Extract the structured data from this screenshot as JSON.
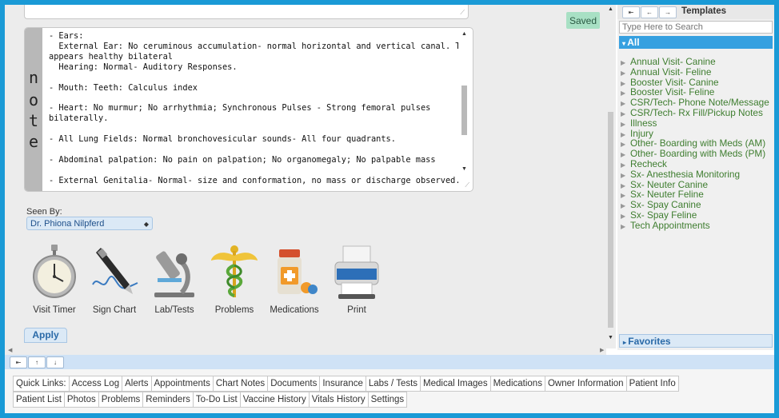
{
  "status": {
    "saved": "Saved"
  },
  "note": {
    "tab_letters": [
      "n",
      "o",
      "t",
      "e"
    ],
    "text": "- Ears:\n  External Ear: No ceruminous accumulation- normal horizontal and vertical canal. TM\nappears healthy bilateral\n  Hearing: Normal- Auditory Responses.\n\n- Mouth: Teeth: Calculus index\n\n- Heart: No murmur; No arrhythmia; Synchronous Pulses - Strong femoral pulses\nbilaterally.\n\n- All Lung Fields: Normal bronchovesicular sounds- All four quadrants.\n\n- Abdominal palpation: No pain on palpation; No organomegaly; No palpable mass\n\n- External Genitalia- Normal- size and conformation, no mass or discharge observed."
  },
  "seen_by": {
    "label": "Seen By:",
    "value": "Dr. Phiona Nilpferd"
  },
  "tools": [
    {
      "label": "Visit Timer"
    },
    {
      "label": "Sign Chart"
    },
    {
      "label": "Lab/Tests"
    },
    {
      "label": "Problems"
    },
    {
      "label": "Medications"
    },
    {
      "label": "Print"
    }
  ],
  "apply_label": "Apply",
  "templates": {
    "title": "Templates",
    "search_placeholder": "Type Here to Search",
    "all_label": "All",
    "items": [
      "Annual Visit- Canine",
      "Annual Visit- Feline",
      "Booster Visit- Canine",
      "Booster Visit- Feline",
      "CSR/Tech- Phone Note/Message",
      "CSR/Tech- Rx Fill/Pickup Notes",
      "Illness",
      "Injury",
      "Other- Boarding with Meds (AM)",
      "Other- Boarding with Meds (PM)",
      "Recheck",
      "Sx- Anesthesia Monitoring",
      "Sx- Neuter Canine",
      "Sx- Neuter Feline",
      "Sx- Spay Canine",
      "Sx- Spay Feline",
      "Tech Appointments"
    ],
    "favorites_label": "Favorites"
  },
  "quick_links": {
    "row1": [
      "Quick Links:",
      "Access Log",
      "Alerts",
      "Appointments",
      "Chart Notes",
      "Documents",
      "Insurance",
      "Labs / Tests",
      "Medical Images",
      "Medications",
      "Owner Information",
      "Patient Info"
    ],
    "row2": [
      "Patient List",
      "Photos",
      "Problems",
      "Reminders",
      "To-Do List",
      "Vaccine History",
      "Vitals History",
      "Settings"
    ]
  },
  "colors": {
    "frame": "#1a9ad6",
    "accent": "#36a0e0",
    "template_text": "#3e7d2f",
    "saved_bg": "#a8e0c4"
  }
}
